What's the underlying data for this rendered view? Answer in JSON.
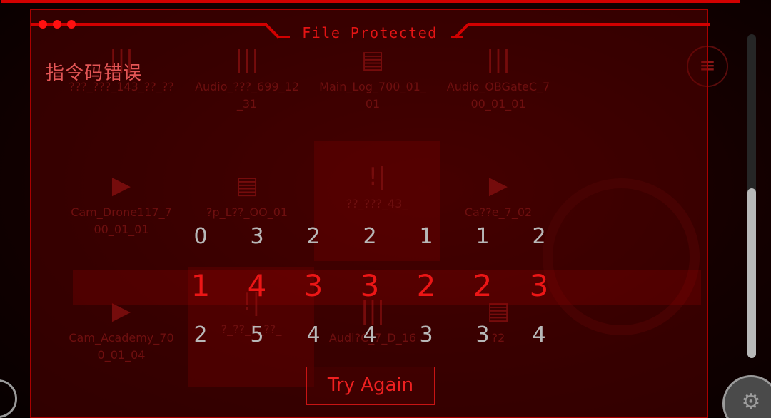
{
  "background": {
    "files": [
      {
        "name": "???_???_143_??_??",
        "icon": "audio-wave-icon"
      },
      {
        "name": "Audio_???_699_12_31",
        "icon": "audio-wave-icon"
      },
      {
        "name": "Main_Log_700_01_01",
        "icon": "document-icon"
      },
      {
        "name": "Audio_OBGateC_700_01_01",
        "icon": "audio-wave-icon"
      },
      {
        "name": "Cam_Drone117_700_01_01",
        "icon": "video-play-icon"
      },
      {
        "name": "?p_L??_OO_01",
        "icon": "document-icon"
      },
      {
        "name": "??_???_43_",
        "icon": "audio-alert-icon"
      },
      {
        "name": "Ca??e_7_02",
        "icon": "video-play-icon"
      },
      {
        "name": "Cam_Academy_700_01_04",
        "icon": "video-play-icon"
      },
      {
        "name": "?_??_1_??_",
        "icon": "audio-alert-icon"
      },
      {
        "name": "Audi?C_7_D_16",
        "icon": "audio-wave-icon"
      },
      {
        "name": "?2",
        "icon": "document-icon"
      }
    ],
    "menu_icon": "menu-icon"
  },
  "dialog": {
    "title": "File Protected",
    "error_message": "指令码错误",
    "digits": {
      "prev": [
        "0",
        "3",
        "2",
        "2",
        "1",
        "1",
        "2"
      ],
      "current": [
        "1",
        "4",
        "3",
        "3",
        "2",
        "2",
        "3"
      ],
      "next": [
        "2",
        "5",
        "4",
        "4",
        "3",
        "3",
        "4"
      ]
    },
    "button_label": "Try Again"
  },
  "colors": {
    "accent": "#d10000",
    "digit_current": "#ec1616",
    "digit_other": "#b8b8b8",
    "background": "#0d0000"
  }
}
